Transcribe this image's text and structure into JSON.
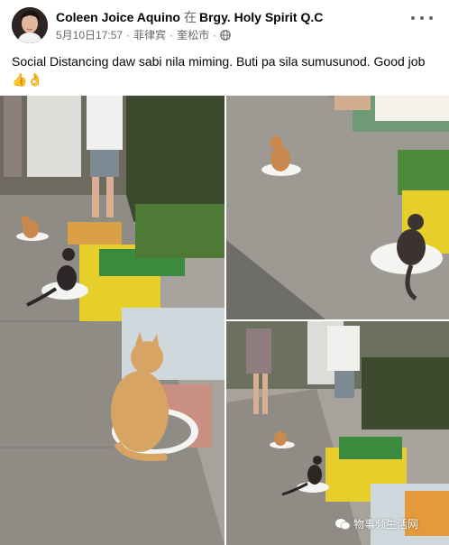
{
  "post": {
    "author": "Coleen Joice Aquino",
    "location_prefix": "在",
    "location": "Brgy. Holy Spirit Q.C",
    "date": "5月10日17:57",
    "country": "菲律宾",
    "city": "奎松市",
    "caption": "Social Distancing daw sabi nila miming. Buti pa sila sumusunod. Good job 👍👌",
    "audience_icon": "globe-icon",
    "more_icon": "more-options-icon"
  },
  "media": {
    "photos": [
      "market-cats-photo",
      "sidewalk-cats-photo",
      "street-market-cats-photo"
    ],
    "watermark": "物事频生活网"
  },
  "colors": {
    "text_primary": "#050505",
    "text_secondary": "#65676b",
    "sidewalk": "#8f8c86",
    "produce_crate": "#e6cf2a",
    "ginger_cat": "#d8a464"
  }
}
